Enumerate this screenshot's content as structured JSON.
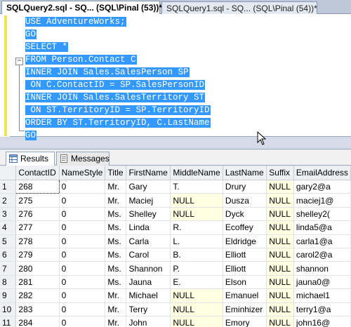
{
  "doc_tabs": {
    "active": "SQLQuery2.sql - SQ... (SQL\\Pinal (53))*",
    "inactive": "SQLQuery1.sql - SQ... (SQL\\Pinal (54))*"
  },
  "editor": {
    "lines": [
      "USE AdventureWorks;",
      "GO",
      "SELECT *",
      "FROM Person.Contact C",
      "INNER JOIN Sales.SalesPerson SP",
      " ON C.ContactID = SP.SalesPersonID",
      "INNER JOIN Sales.SalesTerritory ST",
      " ON ST.TerritoryID = SP.TerritoryID",
      "ORDER BY ST.TerritoryID, C.LastName",
      "GO"
    ],
    "collapse_glyph": "−",
    "selection_color": "#3399ff"
  },
  "results_tabs": {
    "results_label": "Results",
    "messages_label": "Messages"
  },
  "grid": {
    "columns": [
      "ContactID",
      "NameStyle",
      "Title",
      "FirstName",
      "MiddleName",
      "LastName",
      "Suffix",
      "EmailAddress"
    ],
    "rows": [
      {
        "n": "1",
        "cells": [
          "268",
          "0",
          "Mr.",
          "Gary",
          "T.",
          "Drury",
          "NULL",
          "gary2@a"
        ]
      },
      {
        "n": "2",
        "cells": [
          "275",
          "0",
          "Mr.",
          "Maciej",
          "NULL",
          "Dusza",
          "NULL",
          "maciej1@"
        ]
      },
      {
        "n": "3",
        "cells": [
          "276",
          "0",
          "Ms.",
          "Shelley",
          "NULL",
          "Dyck",
          "NULL",
          "shelley2("
        ]
      },
      {
        "n": "4",
        "cells": [
          "277",
          "0",
          "Ms.",
          "Linda",
          "R.",
          "Ecoffey",
          "NULL",
          "linda5@a"
        ]
      },
      {
        "n": "5",
        "cells": [
          "278",
          "0",
          "Ms.",
          "Carla",
          "L.",
          "Eldridge",
          "NULL",
          "carla1@a"
        ]
      },
      {
        "n": "6",
        "cells": [
          "279",
          "0",
          "Ms.",
          "Carol",
          "B.",
          "Elliott",
          "NULL",
          "carol2@a"
        ]
      },
      {
        "n": "7",
        "cells": [
          "280",
          "0",
          "Ms.",
          "Shannon",
          "P.",
          "Elliott",
          "NULL",
          "shannon"
        ]
      },
      {
        "n": "8",
        "cells": [
          "281",
          "0",
          "Ms.",
          "Jauna",
          "E.",
          "Elson",
          "NULL",
          "jauna0@"
        ]
      },
      {
        "n": "9",
        "cells": [
          "282",
          "0",
          "Mr.",
          "Michael",
          "NULL",
          "Emanuel",
          "NULL",
          "michael1"
        ]
      },
      {
        "n": "10",
        "cells": [
          "283",
          "0",
          "Mr.",
          "Terry",
          "NULL",
          "Eminhizer",
          "NULL",
          "terry1@a"
        ]
      },
      {
        "n": "11",
        "cells": [
          "284",
          "0",
          "Mr.",
          "John",
          "NULL",
          "Emory",
          "NULL",
          "john16@"
        ]
      }
    ],
    "null_color": "#ffffe1"
  }
}
